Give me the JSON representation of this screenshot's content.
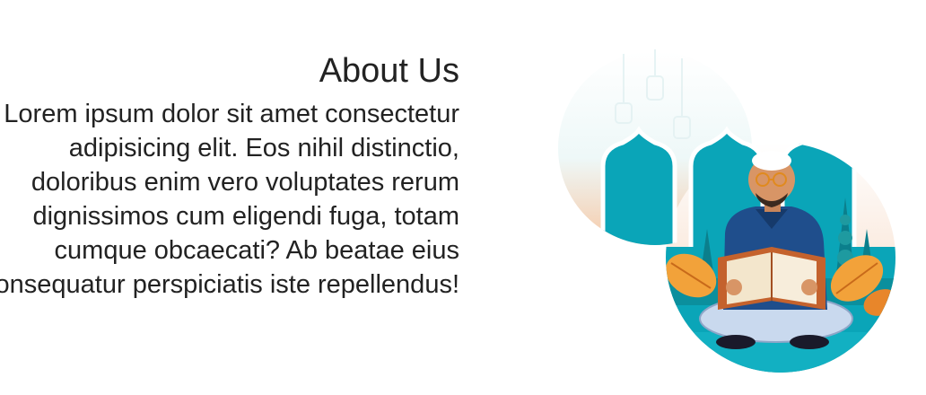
{
  "about": {
    "title": "About Us",
    "body": "Lorem ipsum dolor sit amet consectetur adipisicing elit. Eos nihil distinctio, doloribus enim vero voluptates rerum dignissimos cum eligendi fuga, totam cumque obcaecati? Ab beatae eius consequatur perspiciatis iste repellendus!"
  },
  "illustration": {
    "icon": "man-reading-quran-illustration",
    "colors": {
      "teal": "#0aa5b8",
      "dark_teal": "#0b7f8c",
      "peach": "#f6c9a7",
      "shirt": "#1f4e8c",
      "leaf": "#f2a23a"
    }
  }
}
